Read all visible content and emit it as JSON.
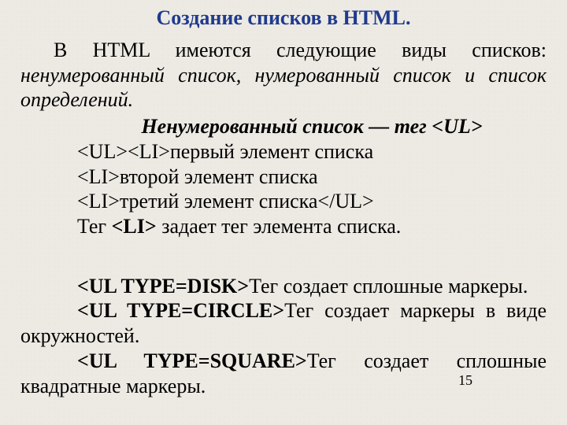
{
  "title": "Создание списков в HTML.",
  "intro_plain1": "В HTML имеются следующие виды списков: ",
  "intro_italic": "ненумерованный список, нумерованный список и список определений.",
  "subhead": "Ненумерованный список — тег <UL>",
  "code": {
    "l1": "<UL><LI>первый элемент списка",
    "l2": "<LI>второй элемент списка",
    "l3": "<LI>третий элемент списка</UL>"
  },
  "li_desc_pre": "Тег ",
  "li_tag": "<LI>",
  "li_desc_post": " задает тег элемента списка.",
  "disk_tag": "<UL TYPE=DISK>",
  "disk_text": "Тег создает сплошные маркеры.",
  "circle_tag": "<UL TYPE=CIRCLE>",
  "circle_text": "Тег создает маркеры в виде окружностей.",
  "square_tag": "<UL TYPE=SQUARE>",
  "square_text": "Тег создает сплошные квадратные маркеры.",
  "page_number": "15"
}
